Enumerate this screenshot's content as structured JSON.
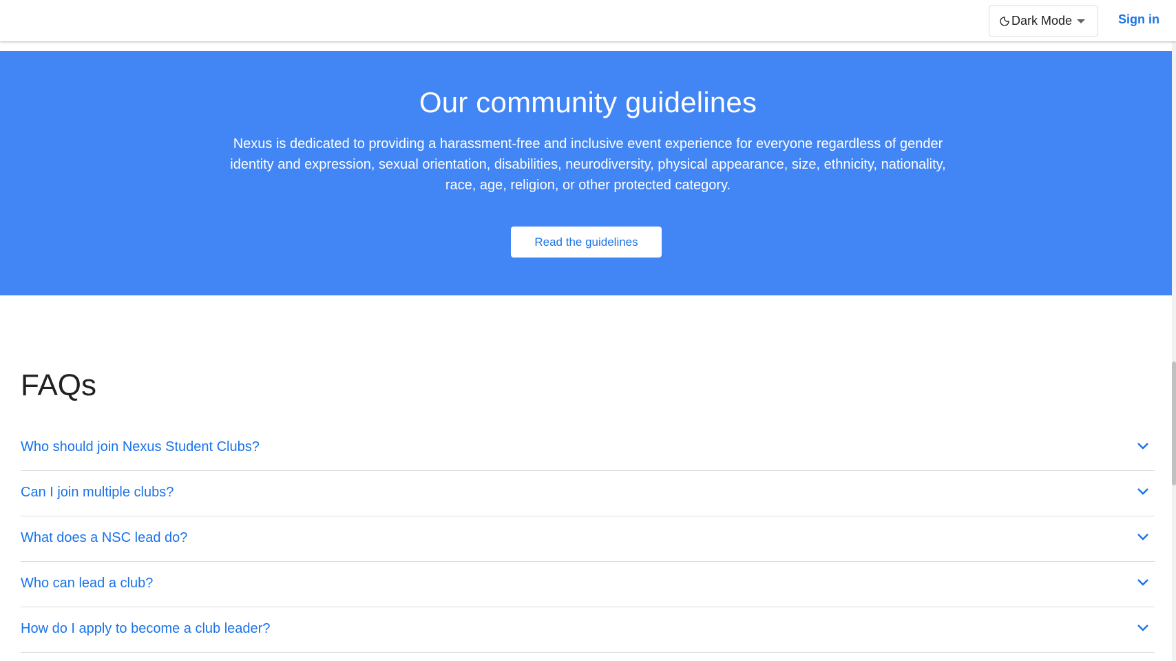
{
  "header": {
    "mode_label": "Dark Mode",
    "signin_label": "Sign in"
  },
  "hero": {
    "title": "Our community guidelines",
    "body": "Nexus is dedicated to providing a harassment-free and inclusive event experience for everyone regardless of gender identity and expression, sexual orientation, disabilities, neurodiversity, physical appearance, size, ethnicity, nationality, race, age, religion, or other protected category.",
    "button_label": "Read the guidelines"
  },
  "faq": {
    "title": "FAQs",
    "items": [
      {
        "question": "Who should join Nexus Student Clubs?"
      },
      {
        "question": "Can I join multiple clubs?"
      },
      {
        "question": "What does a NSC lead do?"
      },
      {
        "question": "Who can lead a club?"
      },
      {
        "question": "How do I apply to become a club leader?"
      }
    ]
  },
  "colors": {
    "accent": "#1a73e8",
    "hero_bg": "#4285f4"
  },
  "icons": {
    "mode": "moon-icon",
    "dropdown": "caret-down-icon",
    "expand": "chevron-down-icon"
  }
}
